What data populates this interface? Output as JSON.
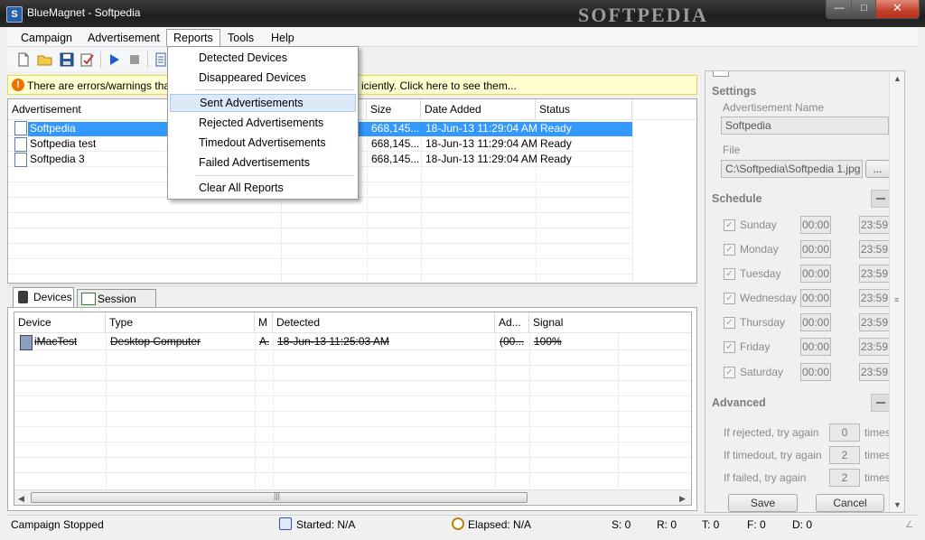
{
  "window": {
    "title": "BlueMagnet - Softpedia",
    "watermark": "SOFTPEDIA"
  },
  "menu": [
    "Campaign",
    "Advertisement",
    "Reports",
    "Tools",
    "Help"
  ],
  "reports_menu": {
    "items": [
      "Detected Devices",
      "Disappeared Devices",
      "Sent Advertisements",
      "Rejected Advertisements",
      "Timedout Advertisements",
      "Failed Advertisements",
      "Clear All Reports"
    ],
    "highlighted": "Sent Advertisements"
  },
  "warning": {
    "text_left": "There are errors/warnings that n",
    "text_right": "iciently. Click here to see them..."
  },
  "ads_table": {
    "columns": [
      "Advertisement",
      "Size",
      "Date Added",
      "Status"
    ],
    "rows": [
      {
        "name": "Softpedia",
        "size": "668,145...",
        "date": "18-Jun-13 11:29:04 AM",
        "status": "Ready",
        "selected": true
      },
      {
        "name": "Softpedia test",
        "size": "668,145...",
        "date": "18-Jun-13 11:29:04 AM",
        "status": "Ready",
        "selected": false
      },
      {
        "name": "Softpedia 3",
        "size": "668,145...",
        "date": "18-Jun-13 11:29:04 AM",
        "status": "Ready",
        "selected": false
      }
    ]
  },
  "tabs": [
    "Devices",
    "Session Log"
  ],
  "devices_table": {
    "columns": [
      "Device",
      "Type",
      "M",
      "Detected",
      "Ad...",
      "Signal"
    ],
    "rows": [
      {
        "device": "iMacTest",
        "type": "Desktop Computer",
        "m": "A.",
        "detected": "18-Jun-13 11:25:03 AM",
        "ad": "(00...",
        "signal": "100%"
      }
    ]
  },
  "settings": {
    "title": "Settings",
    "ad_name_label": "Advertisement Name",
    "ad_name_value": "Softpedia",
    "file_label": "File",
    "file_value": "C:\\Softpedia\\Softpedia 1.jpg",
    "browse_label": "...",
    "schedule_title": "Schedule",
    "days": [
      {
        "day": "Sunday",
        "start": "00:00",
        "end": "23:59"
      },
      {
        "day": "Monday",
        "start": "00:00",
        "end": "23:59"
      },
      {
        "day": "Tuesday",
        "start": "00:00",
        "end": "23:59"
      },
      {
        "day": "Wednesday",
        "start": "00:00",
        "end": "23:59"
      },
      {
        "day": "Thursday",
        "start": "00:00",
        "end": "23:59"
      },
      {
        "day": "Friday",
        "start": "00:00",
        "end": "23:59"
      },
      {
        "day": "Saturday",
        "start": "00:00",
        "end": "23:59"
      }
    ],
    "advanced_title": "Advanced",
    "retries": [
      {
        "label": "If rejected, try  again",
        "value": "0",
        "unit": "times"
      },
      {
        "label": "If timedout, try  again",
        "value": "2",
        "unit": "times"
      },
      {
        "label": "If failed, try  again",
        "value": "2",
        "unit": "times"
      }
    ],
    "save_label": "Save",
    "cancel_label": "Cancel"
  },
  "status": {
    "campaign": "Campaign Stopped",
    "started": "Started: N/A",
    "elapsed": "Elapsed: N/A",
    "s": "S: 0",
    "r": "R: 0",
    "t": "T: 0",
    "f": "F: 0",
    "d": "D: 0"
  },
  "colors": {
    "selection": "#3399ff",
    "warning_bg": "#ffffd0",
    "menu_highlight": "#dbe9f8"
  }
}
